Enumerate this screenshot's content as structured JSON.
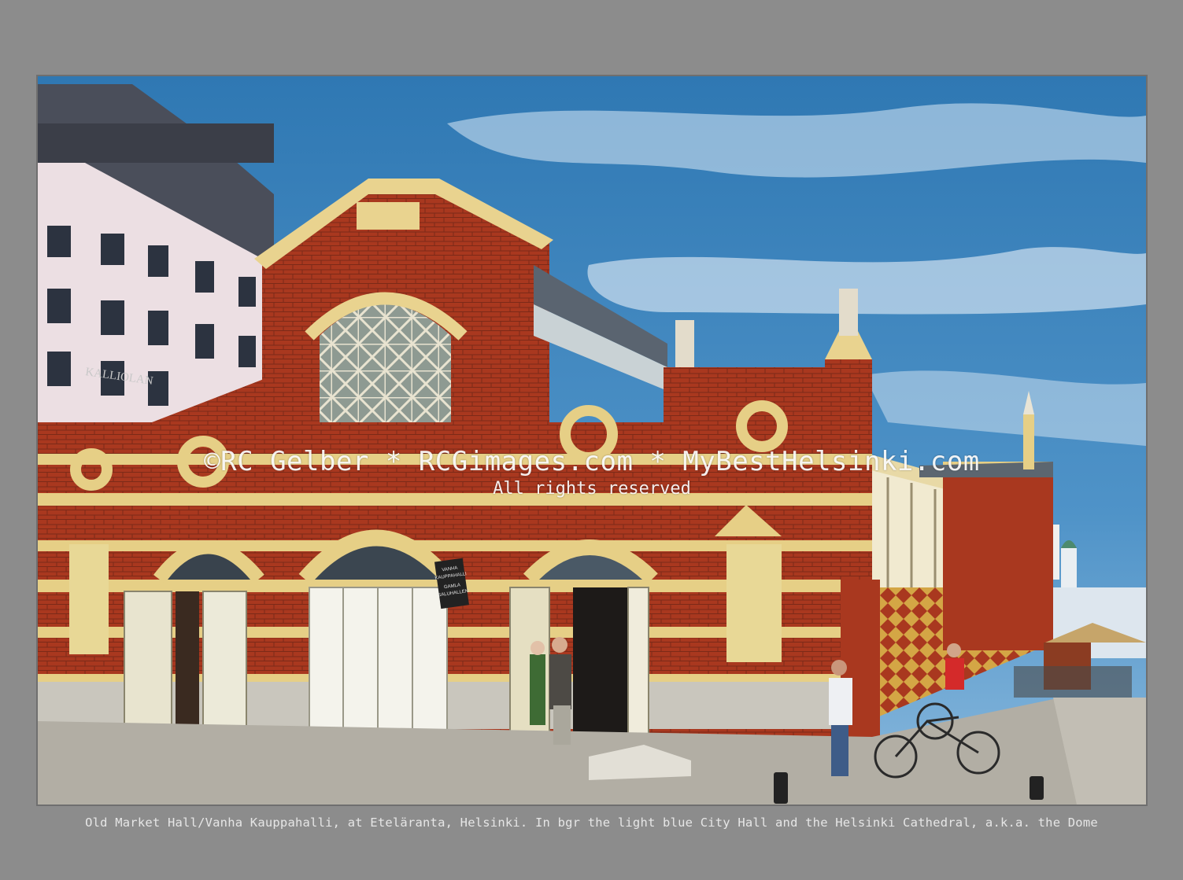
{
  "watermark": {
    "main": "©RC Gelber * RCGimages.com * MyBestHelsinki.com",
    "sub": "All rights reserved"
  },
  "caption": "Old Market Hall/Vanha Kauppahalli, at Eteläranta, Helsinki. In bgr the light blue City Hall and the Helsinki Cathedral, a.k.a. the Dome",
  "photo": {
    "signs": {
      "hotel": "KALLIOLAN",
      "hall_sign_line1": "VANHA",
      "hall_sign_line2": "KAUPPAHALLI",
      "hall_sign_line3": "GAMLA",
      "hall_sign_line4": "SALUHALLEN"
    }
  },
  "colors": {
    "background": "#8c8c8c",
    "sky": "#3f7fb5",
    "brick": "#a83a24",
    "trim": "#e6cf86"
  }
}
